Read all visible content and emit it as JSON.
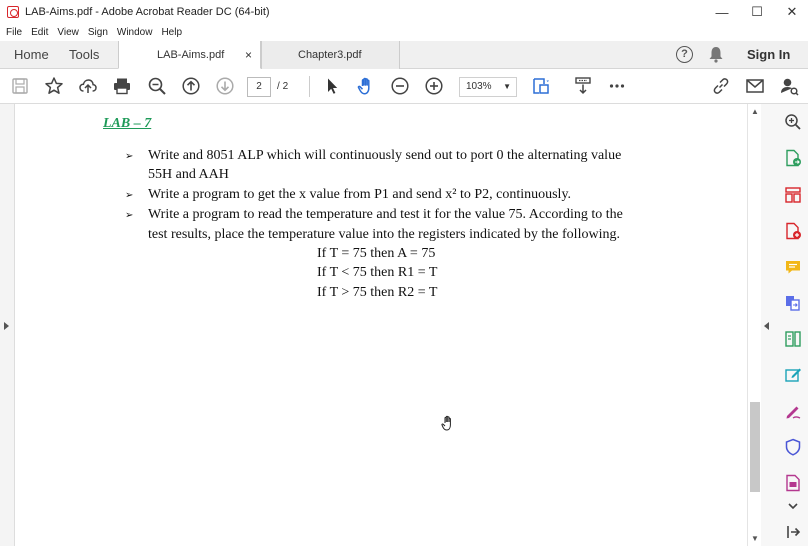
{
  "window": {
    "title": "LAB-Aims.pdf - Adobe Acrobat Reader DC (64-bit)",
    "minimize": "—",
    "maximize": "☐",
    "close": "✕"
  },
  "menu": [
    "File",
    "Edit",
    "View",
    "Sign",
    "Window",
    "Help"
  ],
  "tabs": {
    "home": "Home",
    "tools": "Tools",
    "documents": [
      {
        "label": "LAB-Aims.pdf",
        "close": "×"
      },
      {
        "label": "Chapter3.pdf"
      }
    ],
    "help": "?",
    "sign_in": "Sign In"
  },
  "toolbar": {
    "current_page": "2",
    "page_separator": "/",
    "total_pages": "2",
    "zoom": "103%",
    "zoom_caret": "▼"
  },
  "document": {
    "lab_title": "LAB – 7",
    "bullet_glyph": "➢",
    "items": [
      {
        "lines": [
          "Write and 8051 ALP which will continuously send out to port 0 the alternating value",
          "55H and AAH"
        ]
      },
      {
        "lines": [
          "Write a program to get the x value from P1 and send x² to P2, continuously."
        ]
      },
      {
        "lines": [
          "Write a program to read the temperature and test it for the value 75. According to the",
          "test results, place the temperature value into the registers indicated by the following."
        ]
      }
    ],
    "conditions": [
      "If T = 75 then A = 75",
      "If T < 75 then R1 = T",
      "If T > 75 then R2 = T"
    ]
  },
  "scrollbar": {
    "up": "▲",
    "down": "▼"
  },
  "colors": {
    "lab_title": "#1e9a58",
    "acrobat_red": "#d8262b",
    "accent_blue": "#2d6fd6"
  },
  "right_panel_icons": [
    "zoom-icon",
    "export-pdf-icon",
    "organize-pages-icon",
    "create-pdf-icon",
    "comment-icon",
    "combine-files-icon",
    "compress-icon",
    "edit-pdf-icon",
    "fill-sign-icon",
    "protect-icon",
    "more-tools-icon",
    "expand-icon",
    "pin-icon"
  ]
}
